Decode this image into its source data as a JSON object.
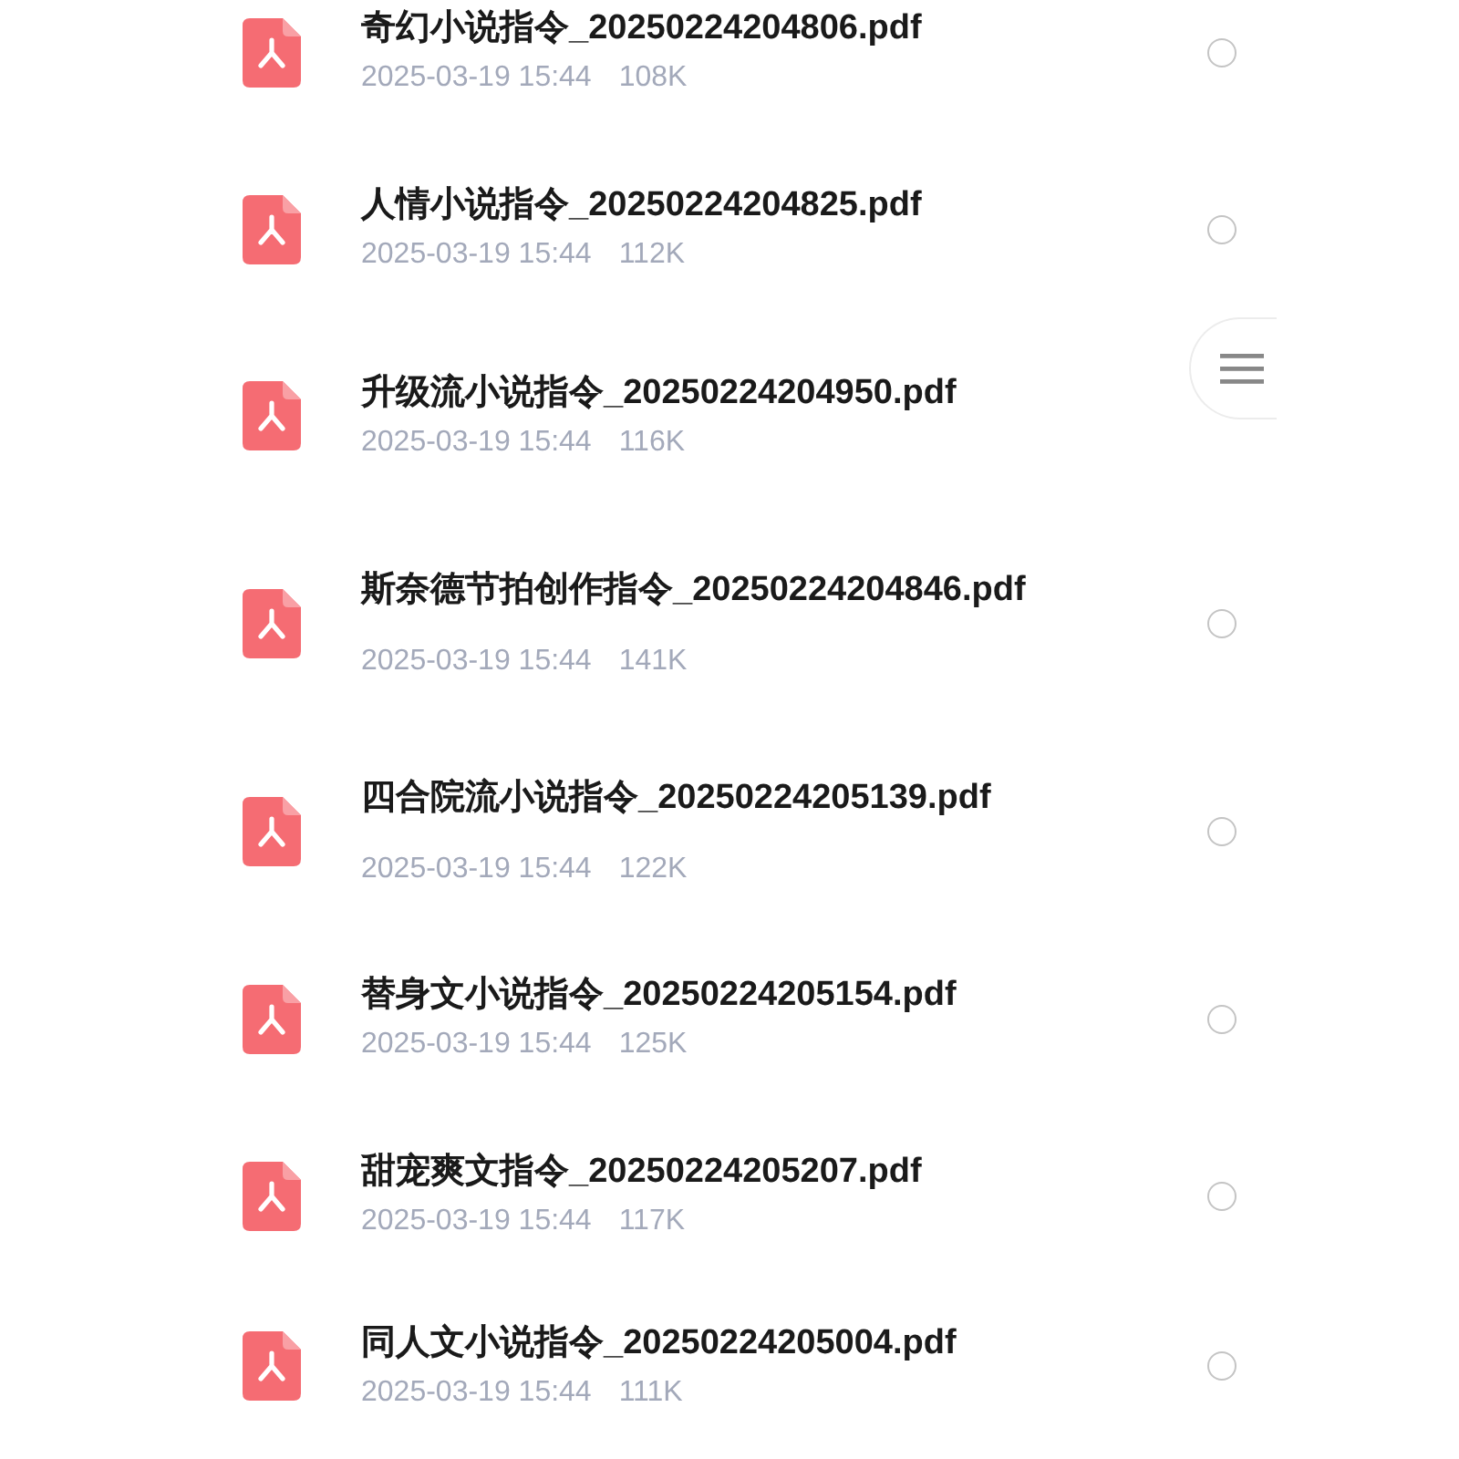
{
  "files": [
    {
      "name": "奇幻小说指令_20250224204806.pdf",
      "date": "2025-03-19 15:44",
      "size": "108K",
      "selected": false
    },
    {
      "name": "人情小说指令_20250224204825.pdf",
      "date": "2025-03-19 15:44",
      "size": "112K",
      "selected": false
    },
    {
      "name": "升级流小说指令_20250224204950.pdf",
      "date": "2025-03-19 15:44",
      "size": "116K"
    },
    {
      "name": "斯奈德节拍创作指令_20250224204846.pdf",
      "date": "2025-03-19 15:44",
      "size": "141K",
      "selected": false
    },
    {
      "name": "四合院流小说指令_20250224205139.pdf",
      "date": "2025-03-19 15:44",
      "size": "122K",
      "selected": false
    },
    {
      "name": "替身文小说指令_20250224205154.pdf",
      "date": "2025-03-19 15:44",
      "size": "125K",
      "selected": false
    },
    {
      "name": "甜宠爽文指令_20250224205207.pdf",
      "date": "2025-03-19 15:44",
      "size": "117K",
      "selected": false
    },
    {
      "name": "同人文小说指令_20250224205004.pdf",
      "date": "2025-03-19 15:44",
      "size": "111K",
      "selected": false
    }
  ]
}
